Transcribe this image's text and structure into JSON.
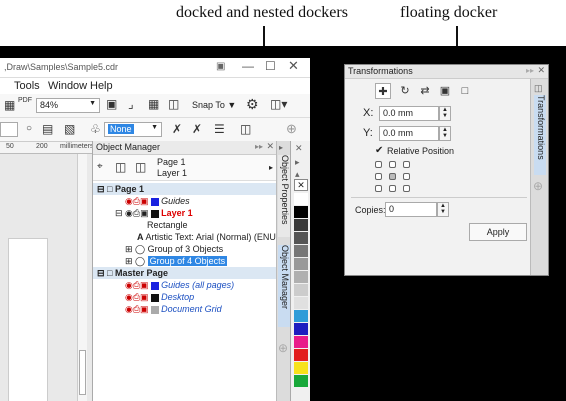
{
  "annotations": {
    "docked_label": "docked and nested dockers",
    "floating_label": "floating docker"
  },
  "main_window": {
    "title_path": ",Draw\\Samples\\Sample5.cdr",
    "menu": [
      "Tools",
      "Window",
      "Help"
    ],
    "zoom_value": "84%",
    "snap_label": "Snap To",
    "fill_value": "None",
    "ruler_ticks": [
      "50",
      "200",
      "millimeters"
    ]
  },
  "object_manager": {
    "title": "Object Manager",
    "page_line": "Page 1",
    "layer_line": "Layer 1",
    "rows": [
      {
        "text": "Page 1"
      },
      {
        "text": "Guides"
      },
      {
        "text": "Layer 1"
      },
      {
        "text": "Rectangle"
      },
      {
        "text": "Artistic Text: Arial (Normal) (ENU)"
      },
      {
        "text": "Group of 3 Objects"
      },
      {
        "text": "Group of 4 Objects"
      },
      {
        "text": "Master Page"
      },
      {
        "text": "Guides (all pages)"
      },
      {
        "text": "Desktop"
      },
      {
        "text": "Document Grid"
      }
    ],
    "tabs": [
      "Object Properties",
      "Object Manager"
    ]
  },
  "palette_colors": [
    "#ffffff",
    "#000000",
    "#3a3a3a",
    "#555555",
    "#777777",
    "#999999",
    "#b0b0b0",
    "#cccccc",
    "#e0e0e0",
    "#2f9cd8",
    "#1d1dbf",
    "#e81c8a",
    "#e21f1f",
    "#f7e21b",
    "#18a83a"
  ],
  "transformations": {
    "title": "Transformations",
    "x_label": "X:",
    "x_value": "0.0 mm",
    "y_label": "Y:",
    "y_value": "0.0 mm",
    "relative_position": "Relative Position",
    "copies_label": "Copies:",
    "copies_value": "0",
    "apply_label": "Apply",
    "side_tab": "Transformations"
  }
}
